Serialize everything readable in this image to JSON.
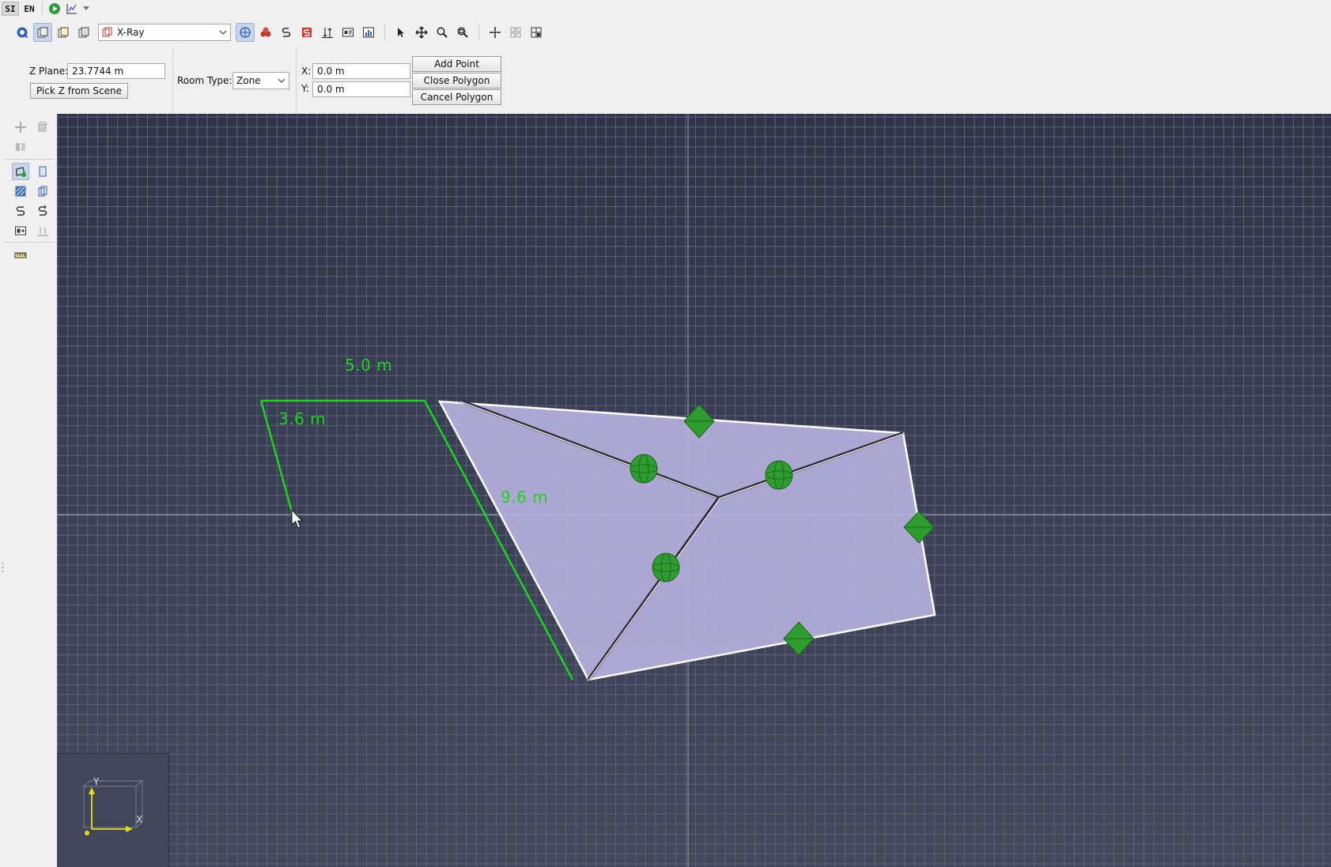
{
  "top_strip": {
    "unit_si": "SI",
    "unit_en": "EN",
    "play_icon": "play-icon",
    "chart_icon": "chart-icon"
  },
  "toolbar": {
    "render_mode": "X-Ray",
    "icons": [
      "navigate-icon",
      "new-scene-icon",
      "copy-scene-icon",
      "paste-scene-icon",
      "render-mode-icon",
      "xray-toggle-icon",
      "materials-icon",
      "vents-icon",
      "walls-icon",
      "measure-icon",
      "data-icon",
      "chart-icon",
      "select-icon",
      "move-icon",
      "zoom-icon",
      "zoom-extents-icon",
      "snap-icon",
      "grid-icon",
      "layout-icon"
    ]
  },
  "props": {
    "z_plane_label": "Z Plane:",
    "z_plane_value": "23.7744 m",
    "pick_z_label": "Pick Z from Scene",
    "room_type_label": "Room Type:",
    "room_type_value": "Zone",
    "x_label": "X:",
    "x_value": "0.0 m",
    "y_label": "Y:",
    "y_value": "0.0 m",
    "add_point_label": "Add Point",
    "close_polygon_label": "Close Polygon",
    "cancel_polygon_label": "Cancel Polygon"
  },
  "viewport": {
    "dimensions": {
      "top": "5.0  m",
      "left": "3.6  m",
      "diagonal": "9.6  m"
    },
    "axes": {
      "x": "X",
      "y": "Y"
    },
    "colors": {
      "grid_line": "#5d6275",
      "polygon_fill": "#b8b2e0",
      "draft_line": "#19d619",
      "node_green": "#2e9c2e"
    }
  }
}
